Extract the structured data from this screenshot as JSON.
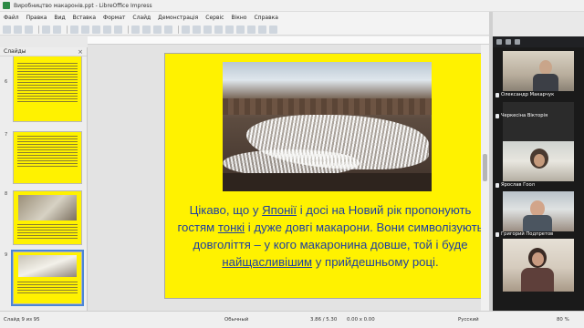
{
  "window": {
    "title": "Виробництво макаронів.ppt - LibreOffice Impress"
  },
  "menu": {
    "items": [
      "Файл",
      "Правка",
      "Вид",
      "Вставка",
      "Формат",
      "Слайд",
      "Демонстрація",
      "Сервіс",
      "Вікно",
      "Справка"
    ]
  },
  "slides_panel": {
    "title": "Слайды",
    "visible_numbers": [
      "6",
      "7",
      "8",
      "9"
    ],
    "selected": "9"
  },
  "slide": {
    "caption_part1": "Цікаво, що у ",
    "caption_link1": "Японії",
    "caption_part2": " і досі на Новий рік пропонують гостям ",
    "caption_link2": "тонкі",
    "caption_part3": " і дуже довгі макарони. Вони символізують довголіття – у кого макаронина довше, той і буде ",
    "caption_link3": "найщасливішим",
    "caption_part4": " у прийдешньому році."
  },
  "participants": [
    {
      "name": "Олександр Макарчук"
    },
    {
      "name": "Черкесіна Вікторія"
    },
    {
      "name": "Ярослав Гоол"
    },
    {
      "name": "Григорий Подпретов"
    },
    {
      "name": ""
    }
  ],
  "status": {
    "slide": "Слайд 9 из 95",
    "layout": "Обычный",
    "position": "3.86 / 5.30",
    "size": "0.00 x 0.00",
    "language": "Русский",
    "zoom": "80 %"
  },
  "colors": {
    "slide_bg": "#fff200",
    "caption": "#1f3fa0",
    "selection": "#4a86d8"
  }
}
